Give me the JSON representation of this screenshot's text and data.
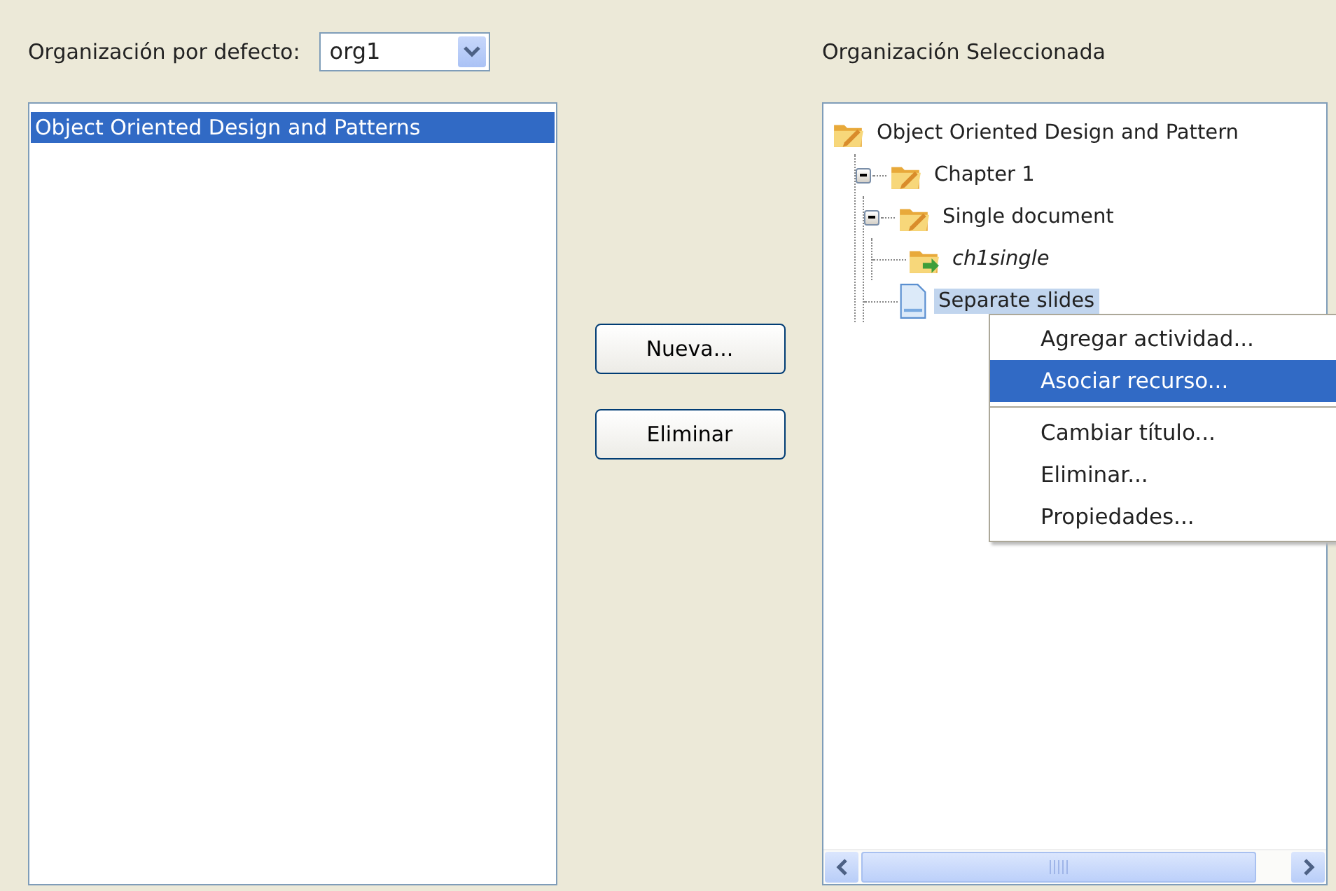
{
  "default_org": {
    "label": "Organización por defecto:",
    "value": "org1"
  },
  "organizations": [
    {
      "label": "Object Oriented Design and Patterns",
      "selected": true
    }
  ],
  "buttons": [
    "Nueva...",
    "Eliminar"
  ],
  "selected_org": {
    "label": "Organización Seleccionada",
    "tree": [
      {
        "label": "Object Oriented Design and Pattern",
        "kind": "folder",
        "selected": false,
        "children": [
          {
            "label": "Chapter 1",
            "kind": "folder",
            "selected": false,
            "expanded": true,
            "children": [
              {
                "label": "Single document",
                "kind": "folder",
                "selected": false,
                "expanded": true,
                "children": [
                  {
                    "label": "ch1single",
                    "kind": "resource",
                    "selected": false
                  }
                ]
              },
              {
                "label": "Separate slides",
                "kind": "page",
                "selected": true
              }
            ]
          }
        ]
      }
    ]
  },
  "context_menu": {
    "items": [
      {
        "label": "Agregar actividad...",
        "selected": false,
        "separator_after": false
      },
      {
        "label": "Asociar recurso...",
        "selected": true,
        "separator_after": true
      },
      {
        "label": "Cambiar título...",
        "selected": false,
        "separator_after": false
      },
      {
        "label": "Eliminar...",
        "selected": false,
        "separator_after": false
      },
      {
        "label": "Propiedades...",
        "selected": false,
        "separator_after": false
      }
    ]
  }
}
